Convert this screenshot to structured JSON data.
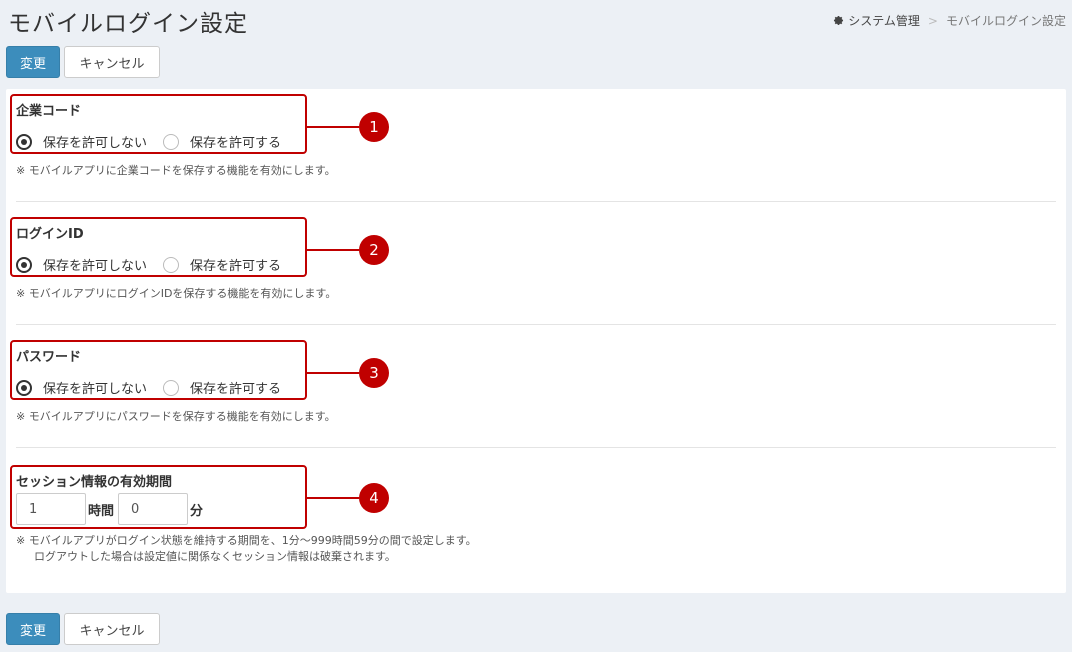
{
  "page": {
    "title": "モバイルログイン設定"
  },
  "breadcrumb": {
    "icon": "gear-icon",
    "parent": "システム管理",
    "separator": ">",
    "current": "モバイルログイン設定"
  },
  "toolbar": {
    "save_label": "変更",
    "cancel_label": "キャンセル"
  },
  "options": {
    "deny": "保存を許可しない",
    "allow": "保存を許可する"
  },
  "fields": [
    {
      "label": "企業コード",
      "selected": "deny",
      "help": "※ モバイルアプリに企業コードを保存する機能を有効にします。",
      "badge": "1"
    },
    {
      "label": "ログインID",
      "selected": "deny",
      "help": "※ モバイルアプリにログインIDを保存する機能を有効にします。",
      "badge": "2"
    },
    {
      "label": "パスワード",
      "selected": "deny",
      "help": "※ モバイルアプリにパスワードを保存する機能を有効にします。",
      "badge": "3"
    }
  ],
  "session": {
    "label": "セッション情報の有効期間",
    "hours_value": "1",
    "hours_unit": "時間",
    "minutes_value": "0",
    "minutes_unit": "分",
    "help_line1": "※ モバイルアプリがログイン状態を維持する期間を、1分〜999時間59分の間で設定します。",
    "help_line2": "ログアウトした場合は設定値に関係なくセッション情報は破棄されます。",
    "badge": "4"
  },
  "colors": {
    "primary": "#3c8dbc",
    "annotation": "#c00000",
    "background": "#ecf0f5"
  }
}
